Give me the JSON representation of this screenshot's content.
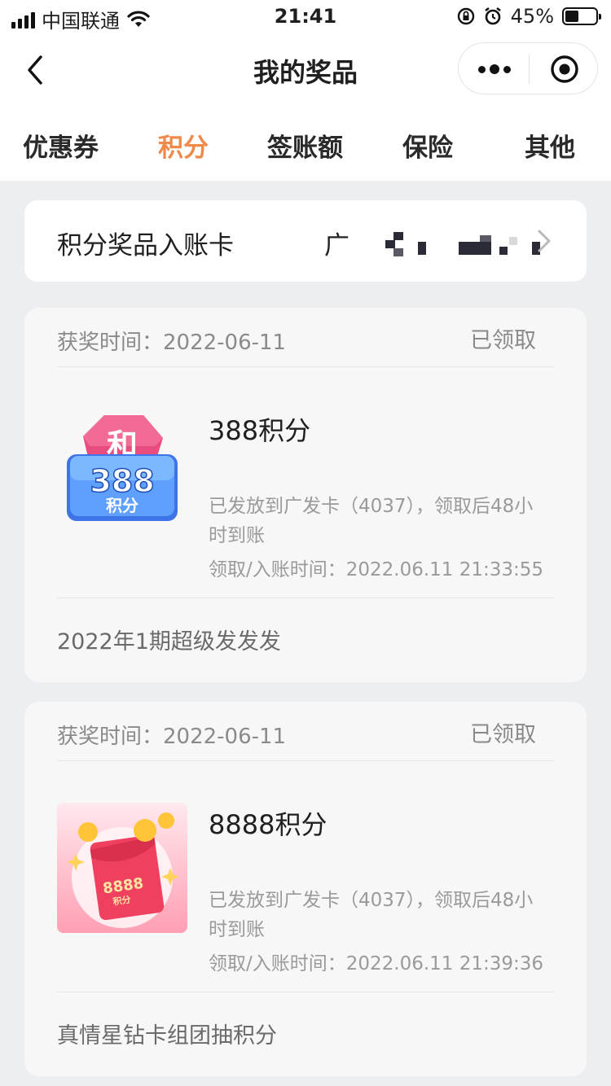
{
  "status_bar": {
    "carrier": "中国联通",
    "time": "21:41",
    "battery_percent": "45%",
    "battery_level": 0.45
  },
  "nav": {
    "title": "我的奖品"
  },
  "tabs": [
    {
      "label": "优惠券",
      "active": false
    },
    {
      "label": "积分",
      "active": true
    },
    {
      "label": "签账额",
      "active": false
    },
    {
      "label": "保险",
      "active": false
    },
    {
      "label": "其他",
      "active": false
    }
  ],
  "account_card": {
    "label": "积分奖品入账卡",
    "value_prefix": "广"
  },
  "prizes": [
    {
      "award_time": "获奖时间：2022-06-11",
      "status": "已领取",
      "title": "388积分",
      "image_text": {
        "top": "和",
        "number": "388",
        "unit": "积分"
      },
      "desc": "已发放到广发卡（4037），领取后48小时到账",
      "claim_time": "领取/入账时间：2022.06.11 21:33:55",
      "activity": "2022年1期超级发发发"
    },
    {
      "award_time": "获奖时间：2022-06-11",
      "status": "已领取",
      "title": "8888积分",
      "image_text": {
        "number": "8888",
        "unit": "积分"
      },
      "desc": "已发放到广发卡（4037），领取后48小时到账",
      "claim_time": "领取/入账时间：2022.06.11 21:39:36",
      "activity": "真情星钻卡组团抽积分"
    }
  ],
  "colors": {
    "accent": "#f08a4b",
    "background": "#edeef2"
  }
}
